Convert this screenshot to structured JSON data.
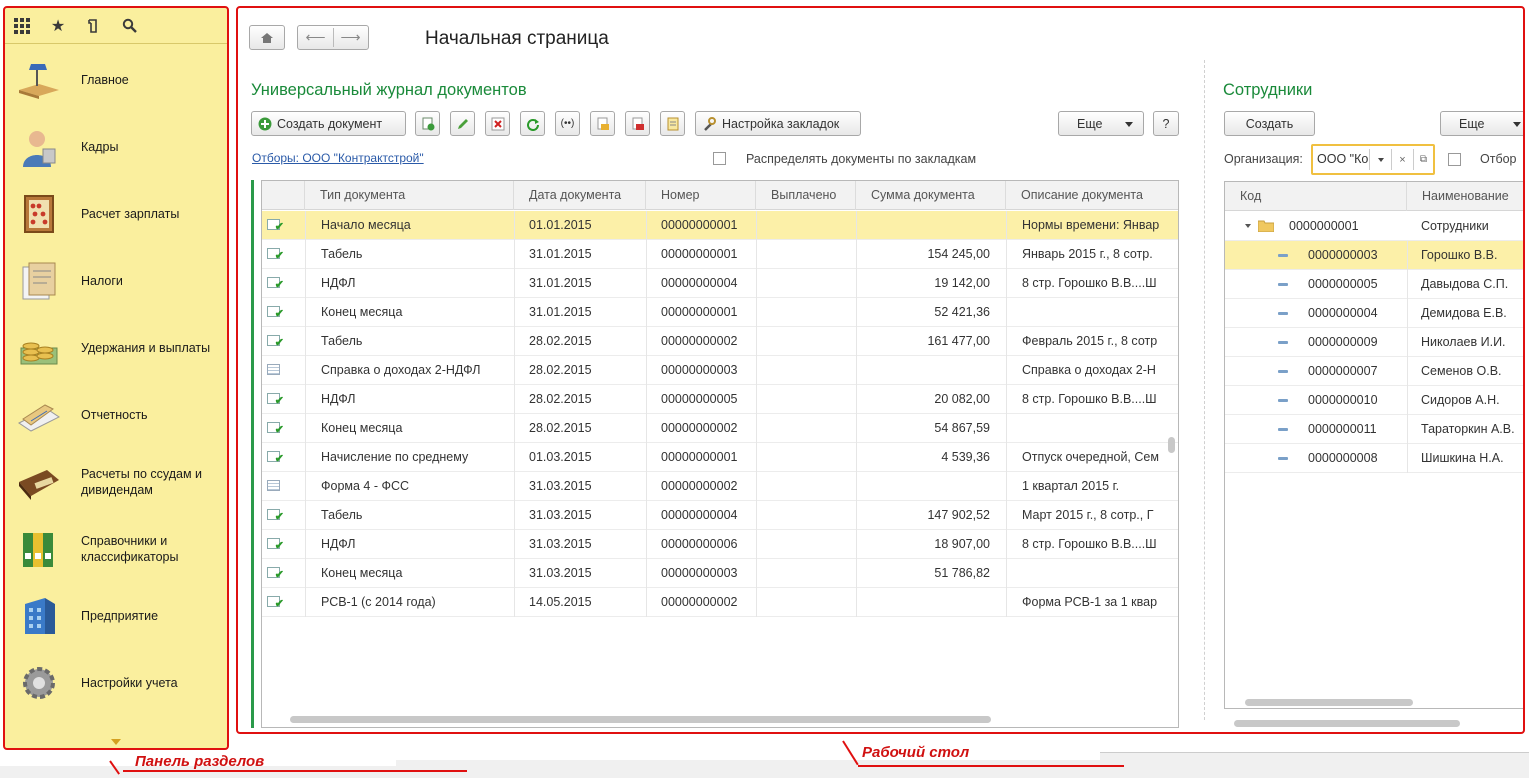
{
  "sidebar": {
    "top_icons": [
      "apps-grid-icon",
      "star-icon",
      "history-icon",
      "search-icon"
    ],
    "items": [
      {
        "label": "Главное"
      },
      {
        "label": "Кадры"
      },
      {
        "label": "Расчет зарплаты"
      },
      {
        "label": "Налоги"
      },
      {
        "label": "Удержания и выплаты"
      },
      {
        "label": "Отчетность"
      },
      {
        "label": "Расчеты по ссудам и дивидендам"
      },
      {
        "label": "Справочники и классификаторы"
      },
      {
        "label": "Предприятие"
      },
      {
        "label": "Настройки учета"
      }
    ]
  },
  "header": {
    "title": "Начальная страница"
  },
  "journal": {
    "title": "Универсальный журнал документов",
    "create_label": "Создать документ",
    "tab_settings_label": "Настройка закладок",
    "more_label": "Еще",
    "help_label": "?",
    "filter_link": "Отборы: ООО \"Контрактстрой\"",
    "distribute_label": "Распределять документы по закладкам",
    "columns": [
      "Тип документа",
      "Дата документа",
      "Номер",
      "Выплачено",
      "Сумма документа",
      "Описание документа"
    ],
    "rows": [
      {
        "type": "Начало месяца",
        "date": "01.01.2015",
        "number": "00000000001",
        "paid": "",
        "sum": "",
        "desc": "Нормы времени: Январ",
        "icon": "posted"
      },
      {
        "type": "Табель",
        "date": "31.01.2015",
        "number": "00000000001",
        "paid": "",
        "sum": "154 245,00",
        "desc": "Январь 2015 г., 8 сотр.",
        "icon": "posted"
      },
      {
        "type": "НДФЛ",
        "date": "31.01.2015",
        "number": "00000000004",
        "paid": "",
        "sum": "19 142,00",
        "desc": "8 стр. Горошко В.В....Ш",
        "icon": "posted"
      },
      {
        "type": "Конец месяца",
        "date": "31.01.2015",
        "number": "00000000001",
        "paid": "",
        "sum": "52 421,36",
        "desc": "",
        "icon": "posted"
      },
      {
        "type": "Табель",
        "date": "28.02.2015",
        "number": "00000000002",
        "paid": "",
        "sum": "161 477,00",
        "desc": "Февраль 2015 г., 8 сотр",
        "icon": "posted"
      },
      {
        "type": "Справка о доходах 2-НДФЛ",
        "date": "28.02.2015",
        "number": "00000000003",
        "paid": "",
        "sum": "",
        "desc": "Справка о доходах 2-Н",
        "icon": "plain"
      },
      {
        "type": "НДФЛ",
        "date": "28.02.2015",
        "number": "00000000005",
        "paid": "",
        "sum": "20 082,00",
        "desc": "8 стр. Горошко В.В....Ш",
        "icon": "posted"
      },
      {
        "type": "Конец месяца",
        "date": "28.02.2015",
        "number": "00000000002",
        "paid": "",
        "sum": "54 867,59",
        "desc": "",
        "icon": "posted"
      },
      {
        "type": "Начисление по среднему",
        "date": "01.03.2015",
        "number": "00000000001",
        "paid": "",
        "sum": "4 539,36",
        "desc": "Отпуск очередной, Сем",
        "icon": "posted"
      },
      {
        "type": "Форма 4 - ФСС",
        "date": "31.03.2015",
        "number": "00000000002",
        "paid": "",
        "sum": "",
        "desc": "1 квартал 2015 г.",
        "icon": "plain"
      },
      {
        "type": "Табель",
        "date": "31.03.2015",
        "number": "00000000004",
        "paid": "",
        "sum": "147 902,52",
        "desc": "Март 2015 г., 8 сотр., Г",
        "icon": "posted"
      },
      {
        "type": "НДФЛ",
        "date": "31.03.2015",
        "number": "00000000006",
        "paid": "",
        "sum": "18 907,00",
        "desc": "8 стр. Горошко В.В....Ш",
        "icon": "posted"
      },
      {
        "type": "Конец месяца",
        "date": "31.03.2015",
        "number": "00000000003",
        "paid": "",
        "sum": "51 786,82",
        "desc": "",
        "icon": "posted"
      },
      {
        "type": "РСВ-1 (с 2014 года)",
        "date": "14.05.2015",
        "number": "00000000002",
        "paid": "",
        "sum": "",
        "desc": "Форма РСВ-1 за 1 квар",
        "icon": "posted"
      }
    ]
  },
  "employees": {
    "title": "Сотрудники",
    "create_label": "Создать",
    "more_label": "Еще",
    "org_label": "Организация:",
    "org_value": "ООО \"Ко",
    "filter_label": "Отбор",
    "columns": [
      "Код",
      "Наименование"
    ],
    "group": {
      "code": "0000000001",
      "name": "Сотрудники"
    },
    "rows": [
      {
        "code": "0000000003",
        "name": "Горошко В.В."
      },
      {
        "code": "0000000005",
        "name": "Давыдова С.П."
      },
      {
        "code": "0000000004",
        "name": "Демидова Е.В."
      },
      {
        "code": "0000000009",
        "name": "Николаев И.И."
      },
      {
        "code": "0000000007",
        "name": "Семенов О.В."
      },
      {
        "code": "0000000010",
        "name": "Сидоров А.Н."
      },
      {
        "code": "0000000011",
        "name": "Тараторкин А.В."
      },
      {
        "code": "0000000008",
        "name": "Шишкина Н.А."
      }
    ]
  },
  "annotations": {
    "sections_panel": "Панель разделов",
    "desktop": "Рабочий стол"
  },
  "colors": {
    "sidebar_bg": "#faef9e",
    "selection": "#fcf0a8",
    "accent_green": "#1a8a3a",
    "annotation_red": "#e01010"
  }
}
